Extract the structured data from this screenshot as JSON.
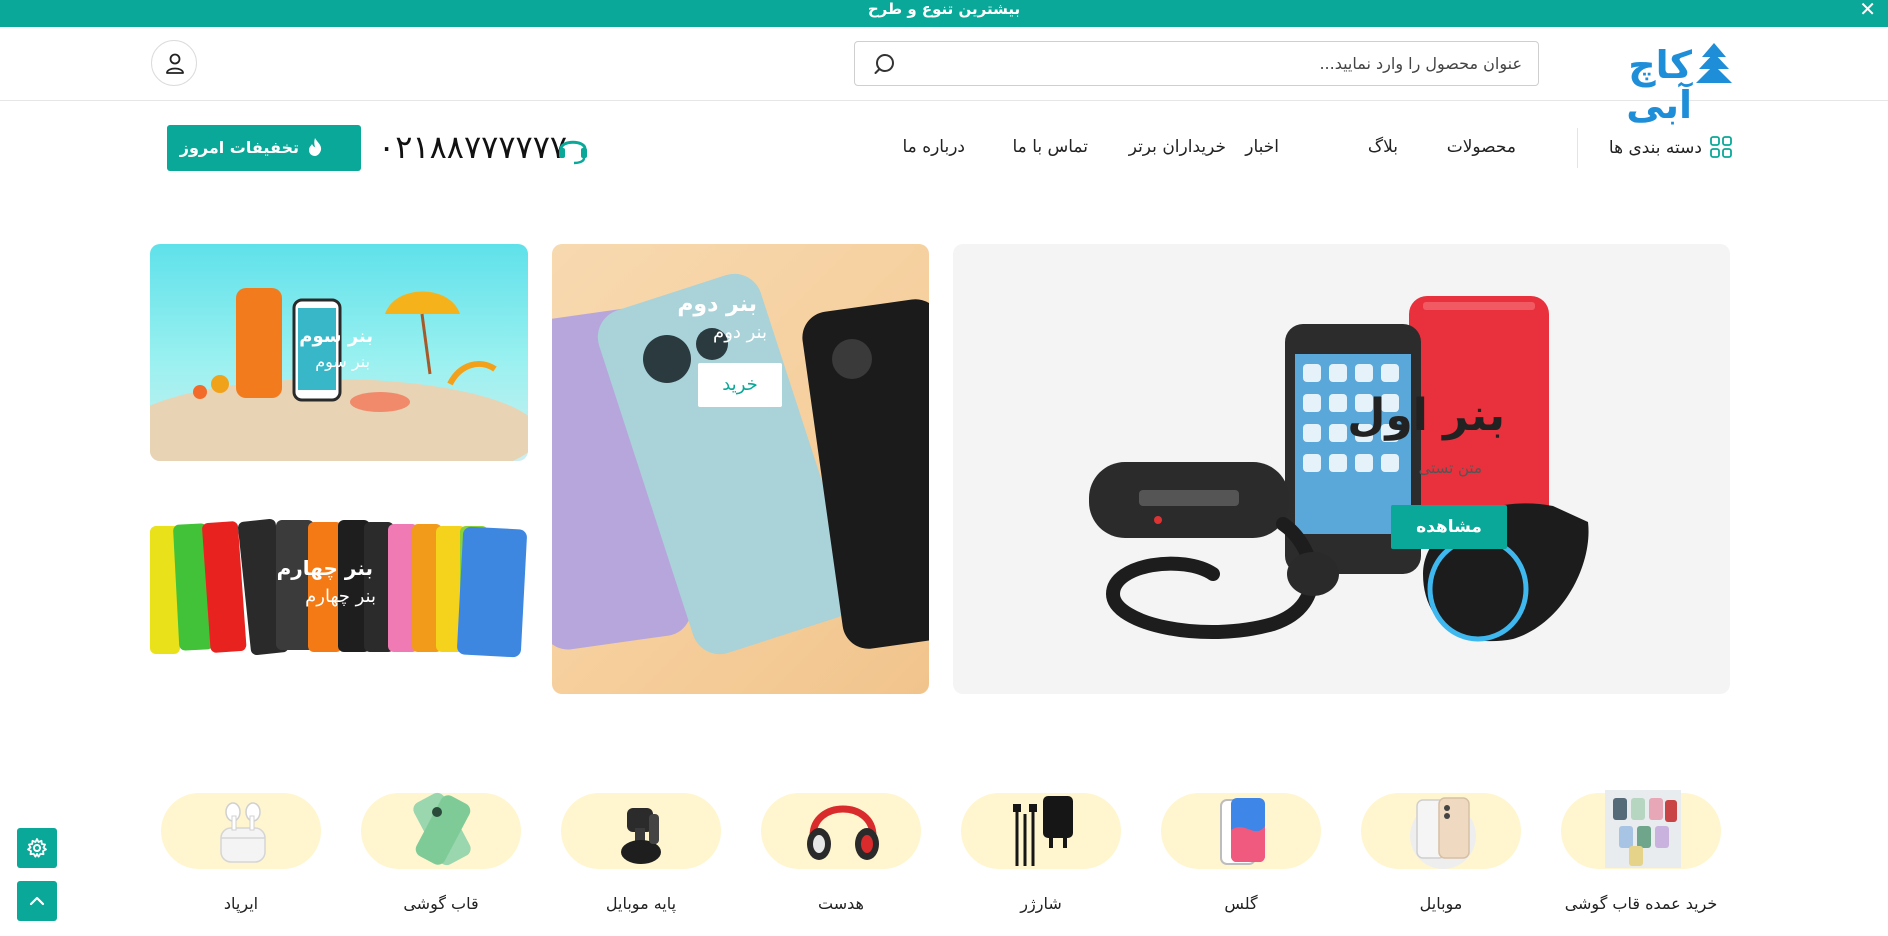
{
  "topbar": {
    "message": "بیشترین تنوع و طرح",
    "close": "✕"
  },
  "header": {
    "logo_text": "کاچ آبی",
    "search_placeholder": "عنوان محصول را وارد نمایید..."
  },
  "nav": {
    "categories_label": "دسته بندی ها",
    "links": [
      "محصولات",
      "بلاگ",
      "اخبار",
      "خریداران برتر",
      "تماس با ما",
      "درباره ما"
    ],
    "phone": "۰۲۱۸۸۷۷۷۷۷۷",
    "deals_label": "تخفیفات امروز"
  },
  "banners": {
    "b1": {
      "title": "بنر اول",
      "subtitle": "متن تستی",
      "button": "مشاهده"
    },
    "b2": {
      "title": "بنر دوم",
      "subtitle": "بنر دوم",
      "button": "خرید"
    },
    "b3": {
      "title": "بنر سوم",
      "subtitle": "بنر سوم"
    },
    "b4": {
      "title": "بنر چهارم",
      "subtitle": "بنر چهارم"
    }
  },
  "categories": [
    {
      "label": "خرید عمده قاب گوشی",
      "icon": "phone-cases-wholesale"
    },
    {
      "label": "موبایل",
      "icon": "mobile-phone"
    },
    {
      "label": "گلس",
      "icon": "screen-glass"
    },
    {
      "label": "شارژر",
      "icon": "charger"
    },
    {
      "label": "هدست",
      "icon": "headset"
    },
    {
      "label": "پایه موبایل",
      "icon": "phone-holder"
    },
    {
      "label": "قاب گوشی",
      "icon": "phone-case"
    },
    {
      "label": "ایرپاد",
      "icon": "airpods"
    }
  ],
  "colors": {
    "brand": "#0aa898",
    "logo": "#1f8ed8",
    "category_bg": "#fff6cf"
  }
}
